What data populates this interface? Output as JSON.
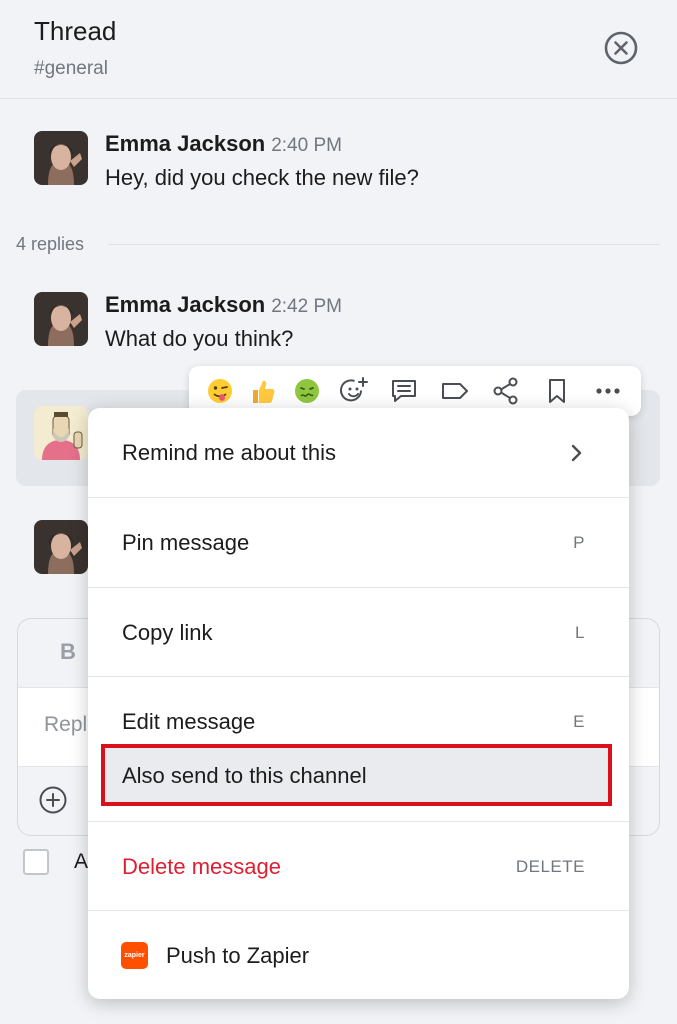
{
  "header": {
    "title": "Thread",
    "channel": "#general"
  },
  "parent_message": {
    "author": "Emma Jackson",
    "time": "2:40 PM",
    "text": "Hey, did you check the new file?"
  },
  "replies_label": "4 replies",
  "reply_message": {
    "author": "Emma Jackson",
    "time": "2:42 PM",
    "text": "What do you think?"
  },
  "reactions": [
    "winking-tongue-emoji",
    "thumbs-up-emoji",
    "nauseated-emoji",
    "add-reaction",
    "reply-in-thread",
    "label",
    "share",
    "bookmark",
    "more"
  ],
  "menu": {
    "items": [
      {
        "label": "Remind me about this",
        "shortcut": ""
      },
      {
        "label": "Pin message",
        "shortcut": "P"
      },
      {
        "label": "Copy link",
        "shortcut": "L"
      },
      {
        "label": "Edit message",
        "shortcut": "E"
      },
      {
        "label": "Also send to this channel",
        "shortcut": ""
      },
      {
        "label": "Delete message",
        "shortcut": "DELETE"
      },
      {
        "label": "Push to Zapier",
        "shortcut": ""
      }
    ],
    "zapier_icon_text": "zapier"
  },
  "composer": {
    "bold_label": "B",
    "placeholder": "Repl"
  },
  "also_send_label": "A",
  "colors": {
    "background": "#f1f3f6",
    "danger": "#e01e32",
    "highlight_border": "#d9111d",
    "zapier": "#ff4f00"
  }
}
